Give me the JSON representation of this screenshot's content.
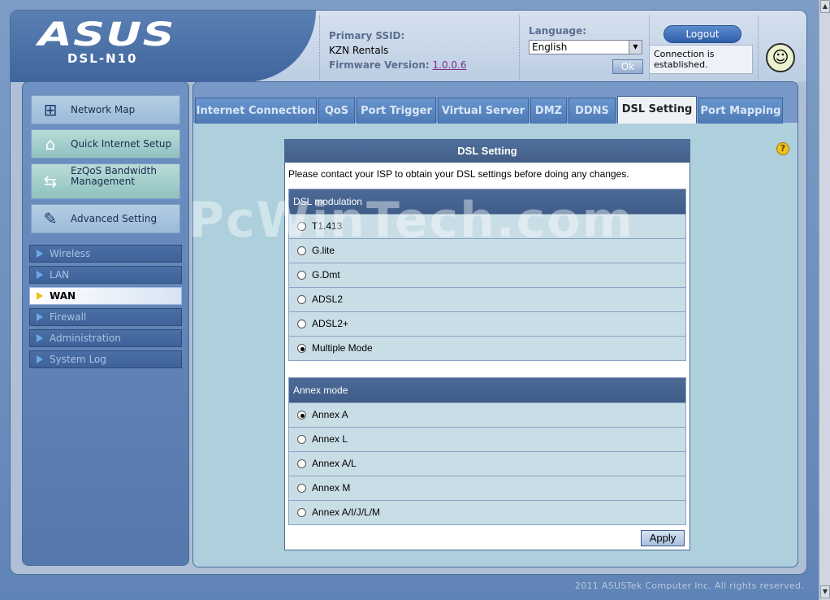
{
  "header": {
    "brand": "ASUS",
    "model": "DSL-N10",
    "ssid_label": "Primary SSID:",
    "ssid_value": "KZN Rentals",
    "firmware_label": "Firmware Version:",
    "firmware_value": "1.0.0.6",
    "language_label": "Language:",
    "language_value": "English",
    "ok_label": "Ok",
    "logout_label": "Logout",
    "connection_status": "Connection is established."
  },
  "sidebar": {
    "items": [
      {
        "label": "Network Map",
        "icon": "network-map-icon"
      },
      {
        "label": "Quick Internet Setup",
        "icon": "router-icon"
      },
      {
        "label": "EzQoS Bandwidth Management",
        "icon": "qos-icon"
      },
      {
        "label": "Advanced Setting",
        "icon": "wrench-icon"
      }
    ],
    "submenu": [
      "Wireless",
      "LAN",
      "WAN",
      "Firewall",
      "Administration",
      "System Log"
    ],
    "active_submenu": "WAN"
  },
  "tabs": [
    "Internet Connection",
    "QoS",
    "Port Trigger",
    "Virtual Server",
    "DMZ",
    "DDNS",
    "DSL Setting",
    "Port Mapping"
  ],
  "active_tab": "DSL Setting",
  "panel": {
    "title": "DSL Setting",
    "note": "Please contact your ISP to obtain your DSL settings before doing any changes.",
    "modulation": {
      "title": "DSL modulation",
      "options": [
        "T1.413",
        "G.lite",
        "G.Dmt",
        "ADSL2",
        "ADSL2+",
        "Multiple Mode"
      ],
      "selected": "Multiple Mode"
    },
    "annex": {
      "title": "Annex mode",
      "options": [
        "Annex A",
        "Annex L",
        "Annex A/L",
        "Annex M",
        "Annex A/I/J/L/M"
      ],
      "selected": "Annex A"
    },
    "apply_label": "Apply"
  },
  "watermark": "PcWinTech.com",
  "footer": "2011 ASUSTek Computer Inc. All rights reserved."
}
